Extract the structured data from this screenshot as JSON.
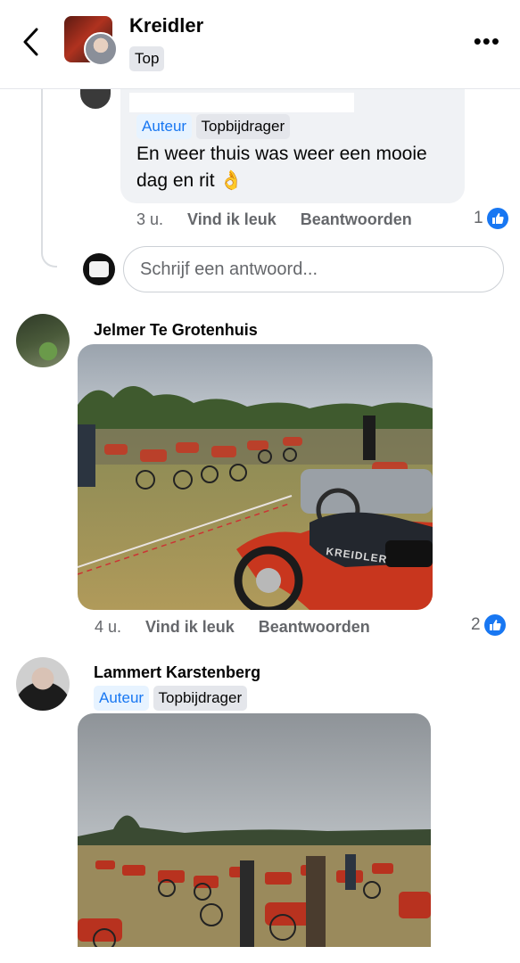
{
  "header": {
    "group_name": "Kreidler",
    "badge": "Top",
    "back_icon": "chevron-left-icon",
    "more_icon": "more-horizontal-icon"
  },
  "reply": {
    "badges": [
      "Auteur",
      "Topbijdrager"
    ],
    "text": "En weer thuis was weer een mooie dag en rit 👌",
    "time": "3 u.",
    "like_label": "Vind ik leuk",
    "reply_label": "Beantwoorden",
    "like_count": "1"
  },
  "reply_input": {
    "placeholder": "Schrijf een antwoord..."
  },
  "comments": [
    {
      "author": "Jelmer Te Grotenhuis",
      "time": "4 u.",
      "like_label": "Vind ik leuk",
      "reply_label": "Beantwoorden",
      "like_count": "2",
      "photo_caption": "KREIDLER"
    },
    {
      "author": "Lammert Karstenberg",
      "badges": [
        "Auteur",
        "Topbijdrager"
      ]
    }
  ],
  "colors": {
    "accent": "#1877f2",
    "bubble": "#f0f2f5",
    "muted": "#65676b"
  }
}
